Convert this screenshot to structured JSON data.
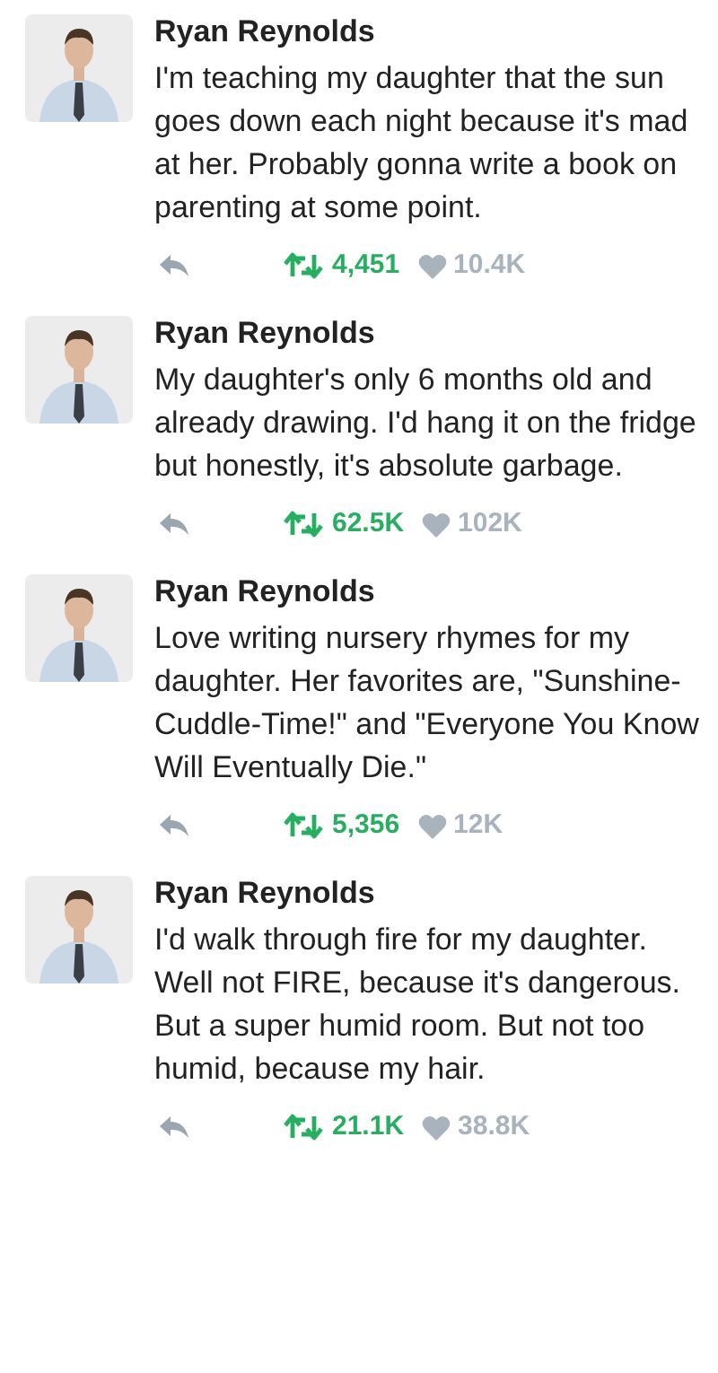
{
  "tweets": [
    {
      "author": "Ryan Reynolds",
      "text": "I'm teaching my daughter that the sun goes down each night because it's mad at her. Probably gonna write a book on parenting at some point.",
      "retweets": "4,451",
      "retweeted": true,
      "likes": "10.4K",
      "liked": false
    },
    {
      "author": "Ryan Reynolds",
      "text": "My daughter's only 6 months old and already drawing. I'd hang it on the fridge but honestly, it's absolute garbage.",
      "retweets": "62.5K",
      "retweeted": true,
      "likes": "102K",
      "liked": false
    },
    {
      "author": "Ryan Reynolds",
      "text": "Love writing nursery rhymes for my daughter. Her favorites are, \"Sunshine-Cuddle-Time!\" and \"Everyone You Know Will Eventually Die.\"",
      "retweets": "5,356",
      "retweeted": true,
      "likes": "12K",
      "liked": false
    },
    {
      "author": "Ryan Reynolds",
      "text": "I'd walk through fire for my daughter. Well not FIRE, because it's dangerous. But a super humid room. But not too humid, because my hair.",
      "retweets": "21.1K",
      "retweeted": true,
      "likes": "38.8K",
      "liked": false
    }
  ]
}
